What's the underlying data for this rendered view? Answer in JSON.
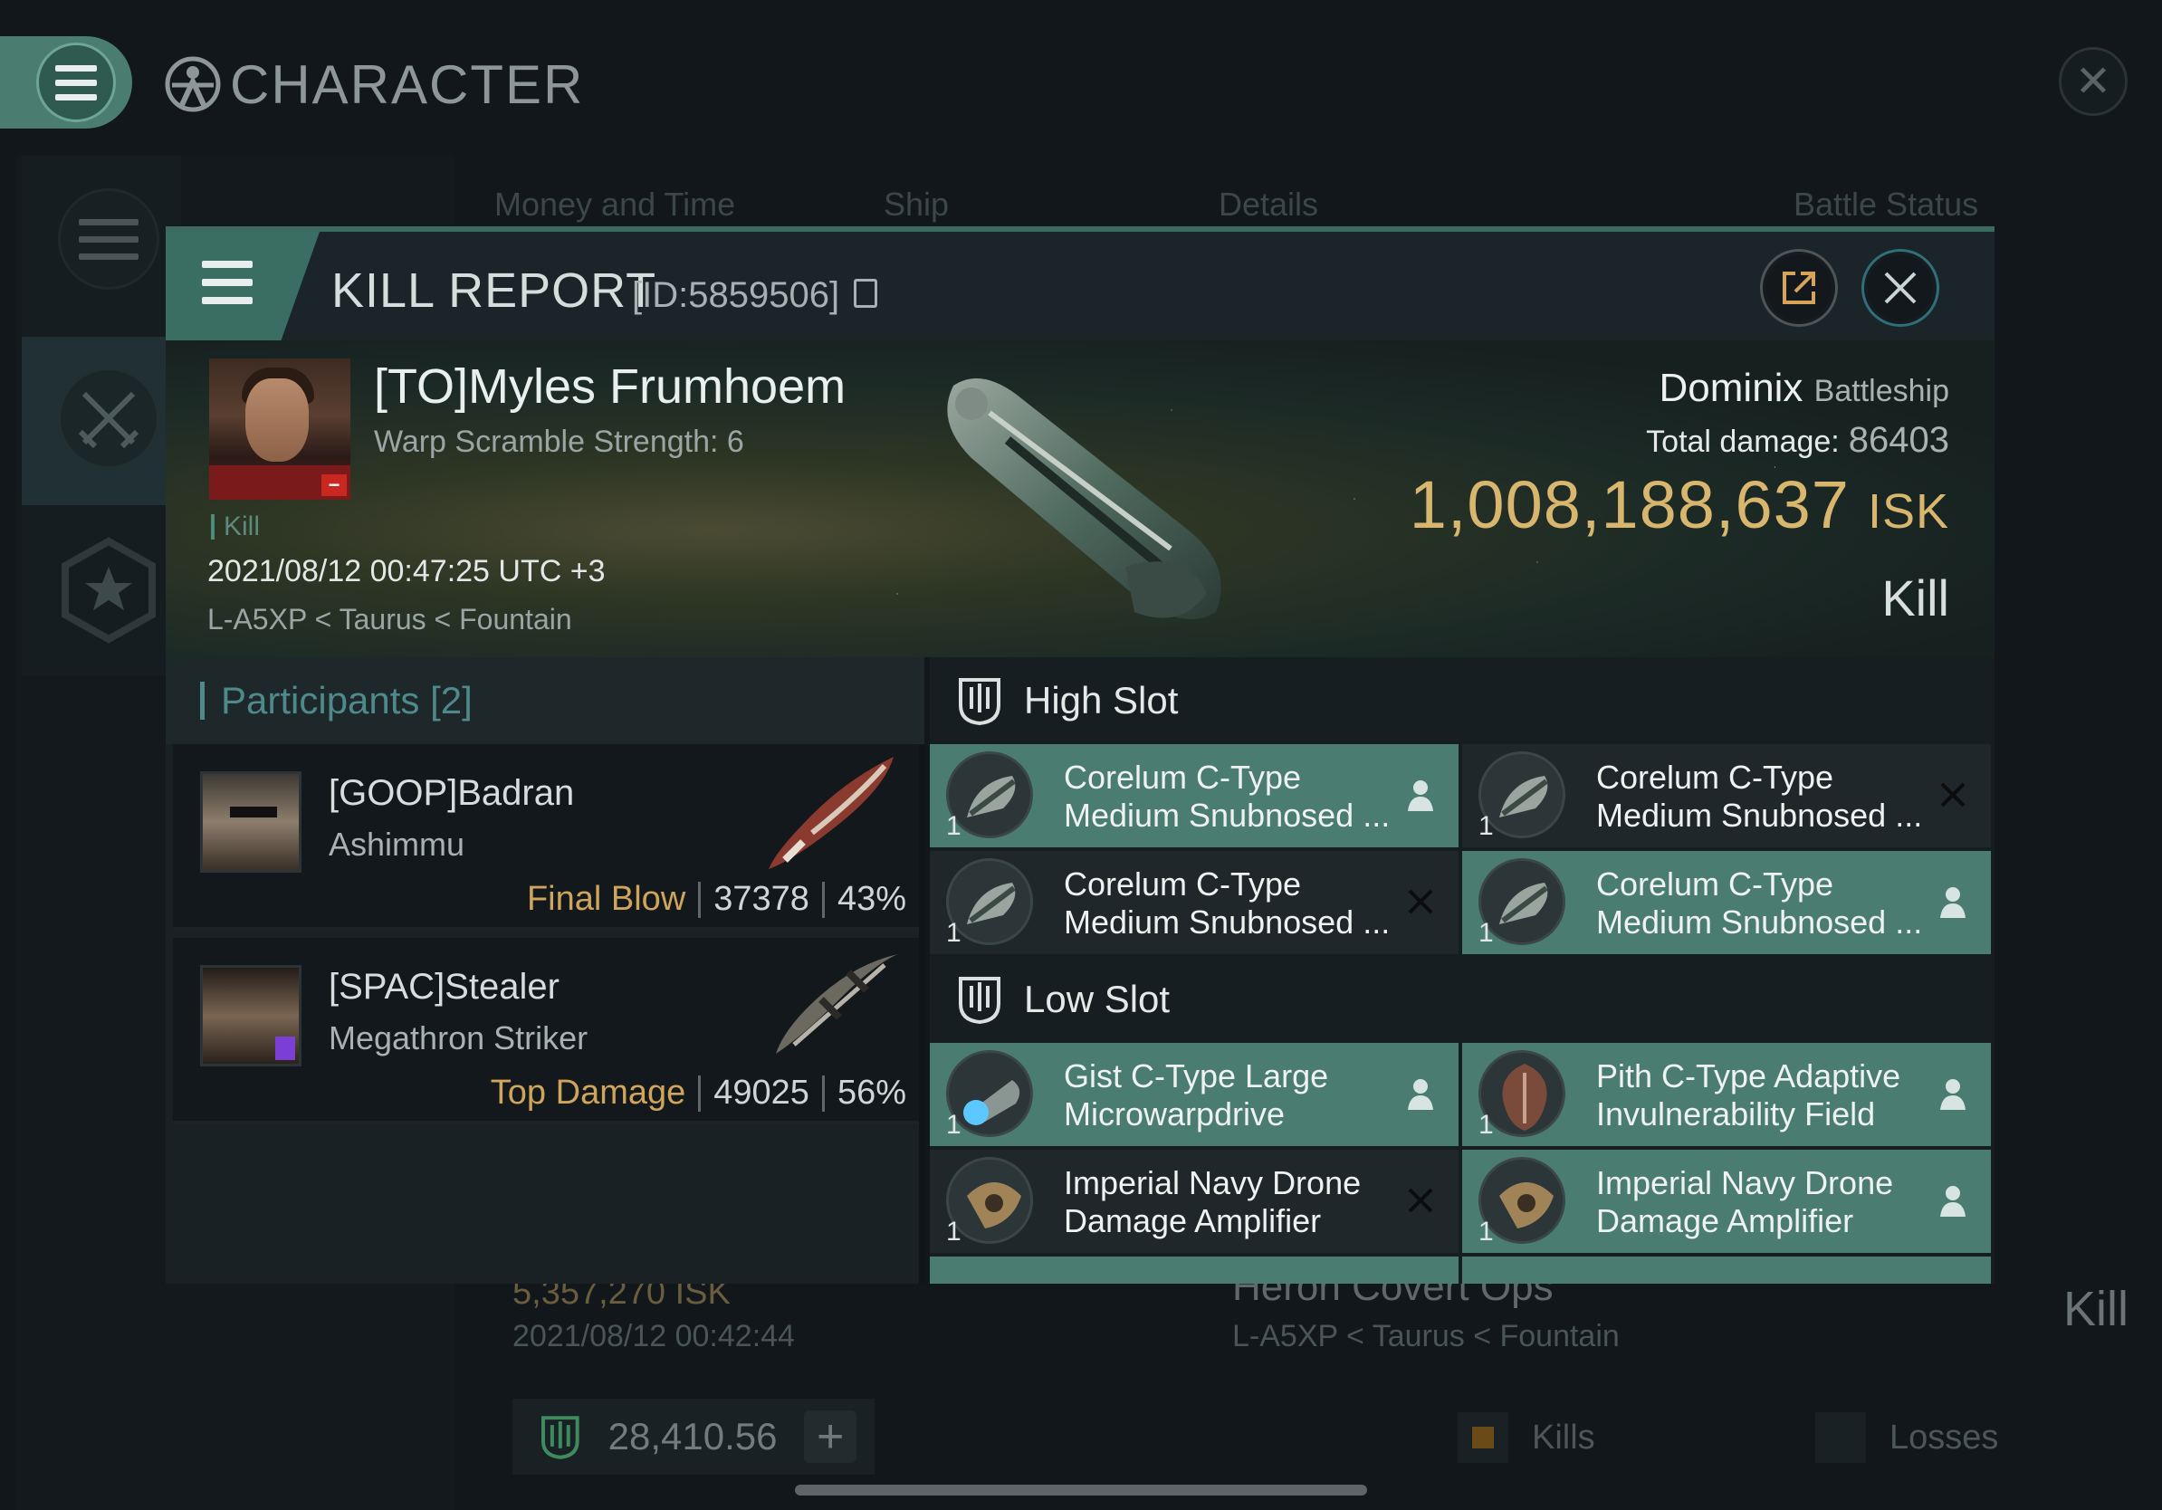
{
  "app": {
    "title": "CHARACTER"
  },
  "background": {
    "tabs": [
      "Money and Time",
      "Ship",
      "Details",
      "Battle Status"
    ],
    "row": {
      "isk": "5,357,270  ISK",
      "date": "2021/08/12  00:42:44",
      "ship": "Heron Covert Ops",
      "location": "L-A5XP < Taurus < Fountain",
      "result": "Kill"
    },
    "footer": {
      "value": "28,410.56",
      "legend_kills": "Kills",
      "legend_losses": "Losses"
    }
  },
  "modal": {
    "title": "KILL REPORT",
    "id_text": "[ID:5859506]",
    "victim": {
      "name": "[TO]Myles Frumhoem",
      "subtitle": "Warp Scramble Strength: 6",
      "tag": "Kill",
      "datetime": "2021/08/12 00:47:25 UTC +3",
      "location": "L-A5XP < Taurus < Fountain"
    },
    "summary": {
      "ship": "Dominix",
      "ship_class": "Battleship",
      "total_damage_label": "Total damage:",
      "total_damage": "86403",
      "isk_value": "1,008,188,637",
      "isk_unit": "ISK",
      "result": "Kill"
    },
    "participants": {
      "header": "Participants [2]",
      "rows": [
        {
          "name": "[GOOP]Badran",
          "ship": "Ashimmu",
          "label": "Final Blow",
          "damage": "37378",
          "percent": "43%"
        },
        {
          "name": "[SPAC]Stealer",
          "ship": "Megathron Striker",
          "label": "Top Damage",
          "damage": "49025",
          "percent": "56%"
        }
      ]
    },
    "high_slot": {
      "title": "High Slot",
      "modules": [
        {
          "line1": "Corelum C-Type",
          "line2": "Medium Snubnosed ...",
          "qty": "1",
          "state": "dropped"
        },
        {
          "line1": "Corelum C-Type",
          "line2": "Medium Snubnosed ...",
          "qty": "1",
          "state": "destroyed"
        },
        {
          "line1": "Corelum C-Type",
          "line2": "Medium Snubnosed ...",
          "qty": "1",
          "state": "destroyed"
        },
        {
          "line1": "Corelum C-Type",
          "line2": "Medium Snubnosed ...",
          "qty": "1",
          "state": "dropped"
        }
      ]
    },
    "low_slot": {
      "title": "Low Slot",
      "modules": [
        {
          "line1": "Gist C-Type Large",
          "line2": "Microwarpdrive",
          "qty": "1",
          "state": "dropped"
        },
        {
          "line1": "Pith C-Type Adaptive",
          "line2": "Invulnerability Field",
          "qty": "1",
          "state": "dropped"
        },
        {
          "line1": "Imperial Navy Drone",
          "line2": "Damage Amplifier",
          "qty": "1",
          "state": "destroyed"
        },
        {
          "line1": "Imperial Navy Drone",
          "line2": "Damage Amplifier",
          "qty": "1",
          "state": "dropped"
        }
      ]
    }
  },
  "colors": {
    "accent": "#4b7c72",
    "isk_gold": "#d8b66e",
    "label_gold": "#cfa55c"
  }
}
